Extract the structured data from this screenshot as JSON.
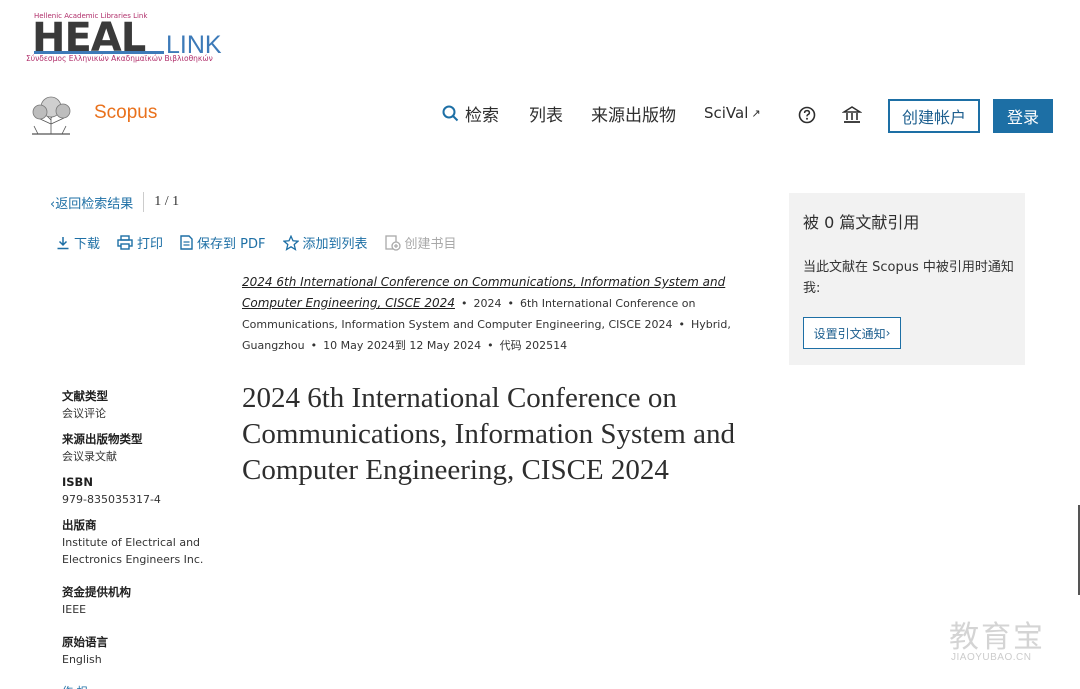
{
  "logo": {
    "top_text": "Hellenic Academic Libraries Link",
    "big_text": "HEAL",
    "link_text": "LINK",
    "sub_text": "Σύνδεσμος Ελληνικών Ακαδημαϊκών Βιβλιοθηκών"
  },
  "header": {
    "brand": "Scopus",
    "nav": {
      "search": "检索",
      "list": "列表",
      "sources": "来源出版物",
      "scival": "SciVal",
      "scival_arrow": "↗"
    },
    "create_account": "创建帐户",
    "login": "登录",
    "icons": [
      "search-icon",
      "help-icon",
      "institution-icon",
      "external-link-icon"
    ]
  },
  "back": {
    "label": "返回检索结果",
    "pager": "1 / 1"
  },
  "toolbar": {
    "download": "下载",
    "print": "打印",
    "save_pdf": "保存到 PDF",
    "add_list": "添加到列表",
    "create_bib": "创建书目"
  },
  "source": {
    "link": "2024 6th International Conference on Communications, Information System and Computer Engineering, CISCE 2024",
    "year": "2024",
    "conference": "6th International Conference on Communications, Information System and Computer Engineering, CISCE 2024",
    "location": "Hybrid, Guangzhou",
    "dates": "10 May 2024到 12 May 2024",
    "code": "代码 202514"
  },
  "meta": {
    "doc_type_label": "文献类型",
    "doc_type": "会议评论",
    "source_type_label": "来源出版物类型",
    "source_type": "会议录文献",
    "isbn_label": "ISBN",
    "isbn": "979-835035317-4",
    "publisher_label": "出版商",
    "publisher": "Institute of Electrical and Electronics Engineers Inc.",
    "funding_label": "资金提供机构",
    "funding": "IEEE",
    "language_label": "原始语言",
    "language": "English",
    "cutoff": "作 相"
  },
  "title": "2024 6th International Conference on Communications, Information System and Computer Engineering, CISCE 2024",
  "cited": {
    "title": "被 0 篇文献引用",
    "desc": "当此文献在 Scopus 中被引用时通知我:",
    "button": "设置引文通知"
  },
  "watermark": {
    "cn": "教育宝",
    "en": "JIAOYUBAO.CN"
  },
  "colors": {
    "scopus_orange": "#e9711c",
    "link_blue": "#1d6fa5",
    "panel_gray": "#f2f2f2"
  }
}
